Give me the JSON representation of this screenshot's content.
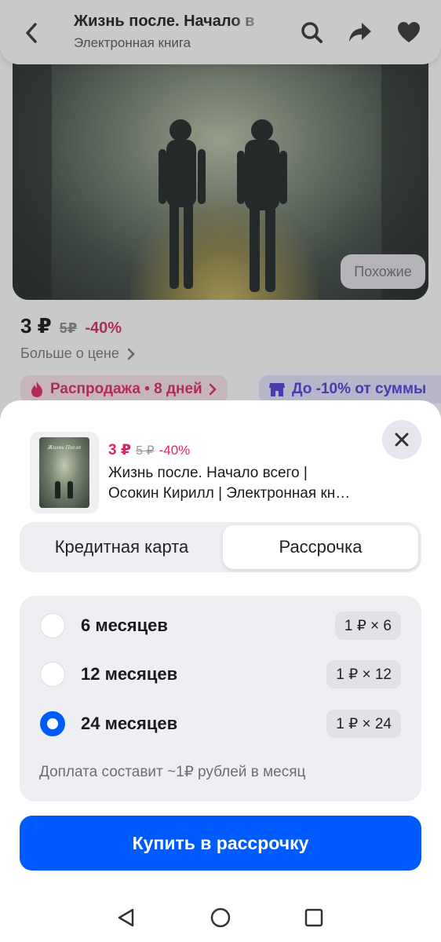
{
  "header": {
    "title": "Жизнь после. Начало в",
    "subtitle": "Электронная книга",
    "icons": [
      "back-icon",
      "search-icon",
      "share-icon",
      "heart-icon"
    ]
  },
  "hero": {
    "similar_label": "Похожие"
  },
  "product": {
    "price": "3 ₽",
    "old_price": "5₽",
    "discount": "-40%",
    "more_price": "Больше о цене",
    "sale_chip": "Распродажа • 8 дней",
    "shop_chip": "До -10% от суммы"
  },
  "sheet": {
    "price": "3 ₽",
    "old_price": "5 ₽",
    "discount": "-40%",
    "name_line1": "Жизнь после. Начало всего |",
    "name_line2": "Осокин Кирилл | Электронная кн…",
    "cover_text": "Жизнь После",
    "tabs": {
      "credit": "Кредитная карта",
      "installment": "Рассрочка",
      "active": "installment"
    },
    "plans": [
      {
        "label": "6 месяцев",
        "payment": "1 ₽ × 6",
        "selected": false
      },
      {
        "label": "12 месяцев",
        "payment": "1 ₽ × 12",
        "selected": false
      },
      {
        "label": "24 месяцев",
        "payment": "1 ₽ × 24",
        "selected": true
      }
    ],
    "note": "Доплата составит ~1₽ рублей в месяц",
    "buy_label": "Купить в рассрочку"
  },
  "colors": {
    "accent": "#005bff",
    "discount": "#e0245e",
    "sheet_bg": "#ffffff",
    "panel_bg": "#eeeff3"
  }
}
